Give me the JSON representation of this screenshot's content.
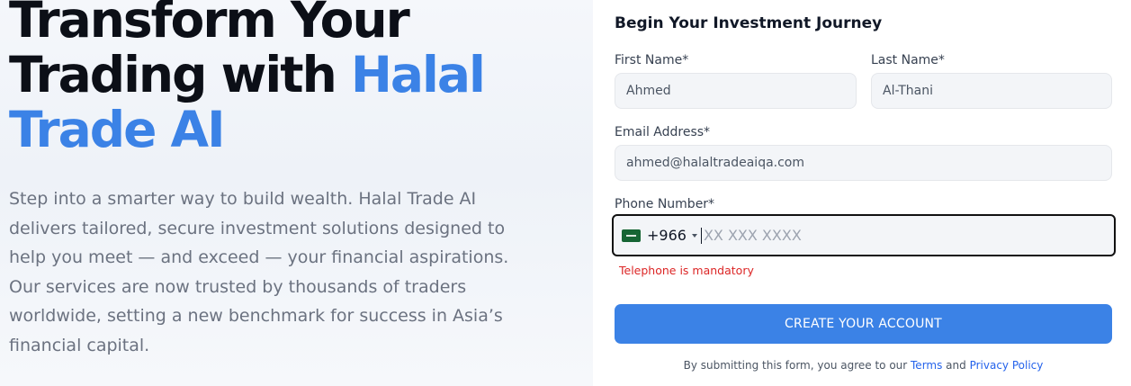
{
  "hero": {
    "title_line1": "Transform Your",
    "title_line2_prefix": "Trading with ",
    "title_accent1": "Halal",
    "title_accent2": "Trade AI",
    "description": "Step into a smarter way to build wealth. Halal Trade AI delivers tailored, secure investment solutions designed to help you meet — and exceed — your financial aspirations. Our services are now trusted by thousands of traders worldwide, setting a new benchmark for success in Asia’s financial capital."
  },
  "form": {
    "title": "Begin Your Investment Journey",
    "first_name": {
      "label": "First Name*",
      "value": "Ahmed"
    },
    "last_name": {
      "label": "Last Name*",
      "value": "Al-Thani"
    },
    "email": {
      "label": "Email Address*",
      "value": "ahmed@halaltradeaiqa.com"
    },
    "phone": {
      "label": "Phone Number*",
      "country_flag": "saudi-arabia-flag",
      "dial_code": "+966",
      "value": "",
      "placeholder": "XX XXX XXXX",
      "error": "Telephone is mandatory"
    },
    "submit_label": "CREATE YOUR ACCOUNT",
    "consent": {
      "prefix": "By submitting this form, you agree to our ",
      "terms_label": "Terms",
      "connector": " and ",
      "privacy_label": "Privacy Policy"
    }
  },
  "colors": {
    "accent": "#3b82e6",
    "error": "#dc2626",
    "title": "#0c0f17"
  }
}
